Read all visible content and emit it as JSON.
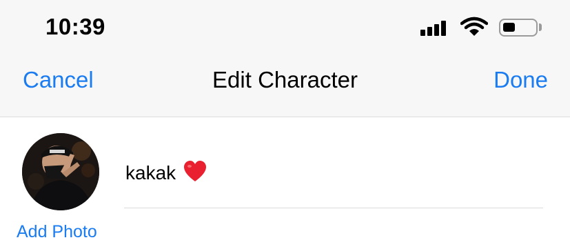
{
  "status_bar": {
    "time": "10:39",
    "signal_icon": "cellular-signal-icon",
    "wifi_icon": "wifi-icon",
    "battery_icon": "battery-icon",
    "battery_level": 0.4
  },
  "nav_bar": {
    "cancel_label": "Cancel",
    "title": "Edit Character",
    "done_label": "Done"
  },
  "character": {
    "name": "kakak",
    "name_emoji_icon": "red-heart-icon",
    "avatar_icon": "character-photo-avatar",
    "add_photo_label": "Add Photo"
  },
  "colors": {
    "accent": "#1a7cf0",
    "bar_background": "#f7f7f7",
    "separator": "#dcdcdc",
    "heart": "#e8202f"
  }
}
